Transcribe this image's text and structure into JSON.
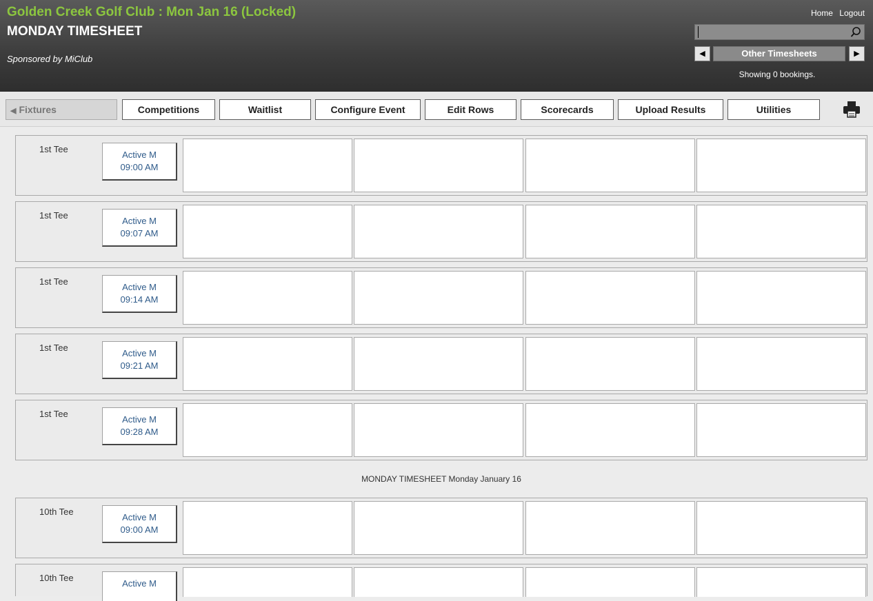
{
  "header": {
    "club_title": "Golden Creek Golf Club : Mon Jan 16 (Locked)",
    "sheet_title": "MONDAY TIMESHEET",
    "sponsor": "Sponsored by MiClub",
    "home_link": "Home",
    "logout_link": "Logout",
    "search_placeholder": "",
    "other_timesheets": "Other Timesheets",
    "prev_arrow": "◀",
    "next_arrow": "▶",
    "booking_count": "Showing 0 bookings."
  },
  "toolbar": {
    "fixtures": "Fixtures",
    "buttons": [
      "Competitions",
      "Waitlist",
      "Configure Event",
      "Edit Rows",
      "Scorecards",
      "Upload Results",
      "Utilities"
    ]
  },
  "slots": [
    {
      "tee": "1st Tee",
      "label": "Active M",
      "time": "09:00 AM"
    },
    {
      "tee": "1st Tee",
      "label": "Active M",
      "time": "09:07 AM"
    },
    {
      "tee": "1st Tee",
      "label": "Active M",
      "time": "09:14 AM"
    },
    {
      "tee": "1st Tee",
      "label": "Active M",
      "time": "09:21 AM"
    },
    {
      "tee": "1st Tee",
      "label": "Active M",
      "time": "09:28 AM"
    },
    {
      "tee": "10th Tee",
      "label": "Active M",
      "time": "09:00 AM"
    },
    {
      "tee": "10th Tee",
      "label": "Active M",
      "time": ""
    }
  ],
  "separator": "MONDAY TIMESHEET Monday January 16",
  "colors": {
    "club_title": "#8cc63f",
    "time_text": "#2f5b8a"
  },
  "icons": [
    "search-icon",
    "printer-icon"
  ]
}
